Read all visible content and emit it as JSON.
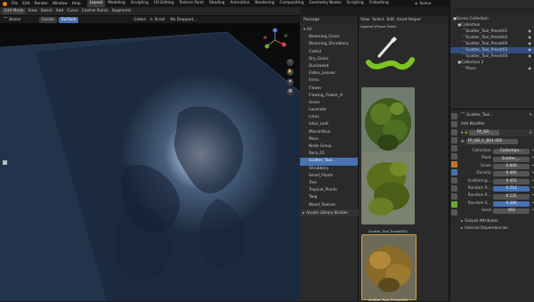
{
  "topbar": {
    "menu": [
      "File",
      "Edit",
      "Render",
      "Window",
      "Help"
    ],
    "workspaces": [
      "Layout",
      "Modeling",
      "Sculpting",
      "UV Editing",
      "Texture Paint",
      "Shading",
      "Animation",
      "Rendering",
      "Compositing",
      "Geometry Nodes",
      "Scripting",
      "Fridashing"
    ],
    "active_workspace": "Layout",
    "scene": "Scene",
    "view_layer": "ViewLayer"
  },
  "viewport_header": {
    "mode": "Edit Mode",
    "menus": [
      "View",
      "Select",
      "Add",
      "Curve",
      "Control Points",
      "Segments"
    ],
    "tool": "Bezier",
    "cursor_btn": "Cursor",
    "surface_btn": "Surface",
    "orientation": "Global",
    "snap": "Scroll"
  },
  "library_header": {
    "drop_label": "No Dropped...",
    "catalog_title": "Package"
  },
  "library": {
    "all_label": "All",
    "items": [
      "Blooming_Grass",
      "Blooming_Shrubbery",
      "Cattail",
      "Dry_Grass",
      "Duckweed",
      "Fallen_Leaves",
      "Ferns",
      "Flower",
      "Flowing_Flower_A",
      "Grass",
      "Lavender",
      "Lotus",
      "lotus_Leaf",
      "Miscanthus",
      "Moss",
      "Node Group",
      "Rock_01",
      "Scatter_Tool...",
      "Shrubbery",
      "Small_Plants",
      "Tree",
      "Tropical_Plants",
      "Twig",
      "Wood_Texture",
      "Unassigned"
    ],
    "selected_item": "Scatter_Tool...",
    "footer": "Assets Library Builder"
  },
  "thumbs_header": {
    "append": "Append (Pause Data)",
    "view": "View",
    "select": "Select",
    "edit": "Edit",
    "asset_helper": "Asset Helper"
  },
  "assets": [
    {
      "label": "Scatter_Tool_Preset000"
    },
    {
      "label": "Scatter_Tool_Preset001"
    },
    {
      "label": "Scatter_Tool_Preset002"
    },
    {
      "label": "Scatter_Tool_Preset003"
    }
  ],
  "outliner": {
    "items": [
      {
        "label": "Scene Collection",
        "indent": 0
      },
      {
        "label": "Collection",
        "indent": 1
      },
      {
        "label": "Scatter_Tool_Preset01",
        "indent": 2
      },
      {
        "label": "Scatter_Tool_Preset02",
        "indent": 2
      },
      {
        "label": "Scatter_Tool_Preset00",
        "indent": 2
      },
      {
        "label": "Scatter_Tool_Preset03",
        "indent": 2
      },
      {
        "label": "Scatter_Tool_Preset04",
        "indent": 2
      },
      {
        "label": "Collection 2",
        "indent": 1
      },
      {
        "label": "Plans",
        "indent": 2
      }
    ],
    "selected_index": 5
  },
  "properties": {
    "object_name": "Scatter_Tool...",
    "modifier_name": "FP_GR...",
    "add_modifier": "Add Modifier",
    "node_group": "FP_GR_C_B01.001",
    "rows": [
      {
        "label": "Collection",
        "value": "Collection..."
      },
      {
        "label": "Plant",
        "value": "Scatter_..."
      },
      {
        "label": "Scale",
        "value": "0.600"
      },
      {
        "label": "Density",
        "value": "0.495"
      },
      {
        "label": "Scattering...",
        "value": "0.451"
      },
      {
        "label": "Random R...",
        "value": "0.514"
      },
      {
        "label": "Random R...",
        "value": "0.131"
      },
      {
        "label": "Random S...",
        "value": "0.386"
      },
      {
        "label": "Seed",
        "value": "493"
      }
    ],
    "highlighted_rows": [
      5,
      7
    ],
    "output_attributes": "Output Attributes",
    "internal_dependencies": "Internal Dependencies"
  },
  "colors": {
    "accent": "#4772b3",
    "panel": "#2a2a2a",
    "header": "#262626",
    "topbar": "#151515"
  }
}
